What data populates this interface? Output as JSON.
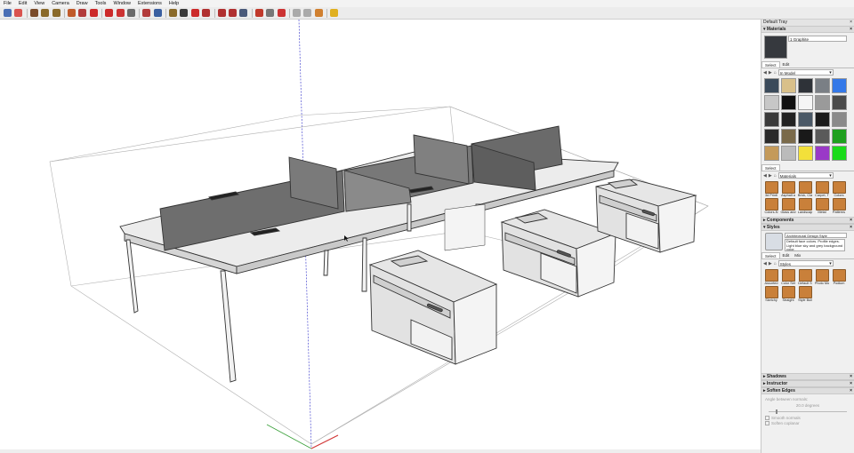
{
  "menu": [
    "File",
    "Edit",
    "View",
    "Camera",
    "Draw",
    "Tools",
    "Window",
    "Extensions",
    "Help"
  ],
  "toolbar": {
    "buttons": [
      {
        "icon": "select-arrow-icon",
        "color": "#4a6fb5"
      },
      {
        "icon": "eraser-icon",
        "color": "#d9534f"
      },
      {
        "icon": "line-pencil-icon",
        "color": "#7a4b2a"
      },
      {
        "icon": "arc-icon",
        "color": "#8a6a2a"
      },
      {
        "icon": "rectangle-icon",
        "color": "#8a6a2a"
      },
      {
        "icon": "push-pull-icon",
        "color": "#c05a2a"
      },
      {
        "icon": "offset-icon",
        "color": "#b23b3b"
      },
      {
        "icon": "move-icon",
        "color": "#cc2a2a"
      },
      {
        "icon": "rotate-icon",
        "color": "#cc2a2a"
      },
      {
        "icon": "scale-icon",
        "color": "#cc3333"
      },
      {
        "icon": "tape-measure-icon",
        "color": "#6a6a6a"
      },
      {
        "icon": "paint-bucket-icon",
        "color": "#b23b3b"
      },
      {
        "icon": "orbit-icon",
        "color": "#3a5fa0"
      },
      {
        "icon": "pan-icon",
        "color": "#8a6a2a"
      },
      {
        "icon": "zoom-icon",
        "color": "#3a3a3a"
      },
      {
        "icon": "zoom-extents-icon",
        "color": "#cc2a2a"
      },
      {
        "icon": "warehouse-icon",
        "color": "#b03030"
      },
      {
        "icon": "extension-warehouse-icon",
        "color": "#b03030"
      },
      {
        "icon": "layout-icon",
        "color": "#b03030"
      },
      {
        "icon": "section-plane-icon",
        "color": "#4a5a7a"
      },
      {
        "icon": "model-info-icon",
        "color": "#c0392b"
      },
      {
        "icon": "tag-icon",
        "color": "#777777"
      },
      {
        "icon": "sandbox-icon",
        "color": "#cc3333"
      },
      {
        "icon": "circle-icon",
        "color": "#aaaaaa"
      },
      {
        "icon": "pencil-icon",
        "color": "#aaaaaa"
      },
      {
        "icon": "ruby-icon",
        "color": "#d08030"
      },
      {
        "icon": "bulb-icon",
        "color": "#e0b020"
      }
    ]
  },
  "tray": {
    "title": "Default Tray",
    "materials": {
      "header": "Materials",
      "name": "1 Graphite",
      "tabs": [
        "Select",
        "Edit"
      ],
      "collection": "In Model",
      "swatches": [
        "#3a4a5a",
        "#d9c08a",
        "#2e3238",
        "#7a7f85",
        "#3478e8",
        "#c7c7c7",
        "#111111",
        "#f5f5f5",
        "#9a9a9a",
        "#4a4a4a",
        "#3a3a3a",
        "#222222",
        "#4a5866",
        "#1a1a1a",
        "#8a8a8a",
        "#2a2a2a",
        "#7a6a4a",
        "#191919",
        "#5a5a5a",
        "#1ea01e",
        "#c49a5a",
        "#bbbbbb",
        "#f3e03a",
        "#9a39c7",
        "#1adb1a"
      ],
      "library_collection": "Materials",
      "library": [
        "3d Printi",
        "Asphalt a",
        "Brick, Cla",
        "Carpet, T",
        "Colors",
        "Colors-N",
        "Glass and",
        "Landscap",
        "Metal",
        "Patterns"
      ]
    },
    "components": {
      "header": "Components"
    },
    "styles": {
      "header": "Styles",
      "name": "Architectural Design Style",
      "description": "Default face colors. Profile edges. Light blue sky and grey background color.",
      "tabs": [
        "Select",
        "Edit",
        "Mix"
      ],
      "collection": "Styles",
      "library": [
        "Assorted",
        "Color Set",
        "Default S",
        "Photo Mo",
        "Podium",
        "Sketchy",
        "Straight",
        "Style Buil"
      ]
    },
    "collapsed": [
      "Shadows",
      "Instructor",
      "Soften Edges"
    ],
    "soften": {
      "angle_label": "Angle between normals:",
      "angle_value": "20.0  degrees",
      "smooth_normals": "Smooth normals",
      "soften_coplanar": "Soften coplanar"
    }
  }
}
